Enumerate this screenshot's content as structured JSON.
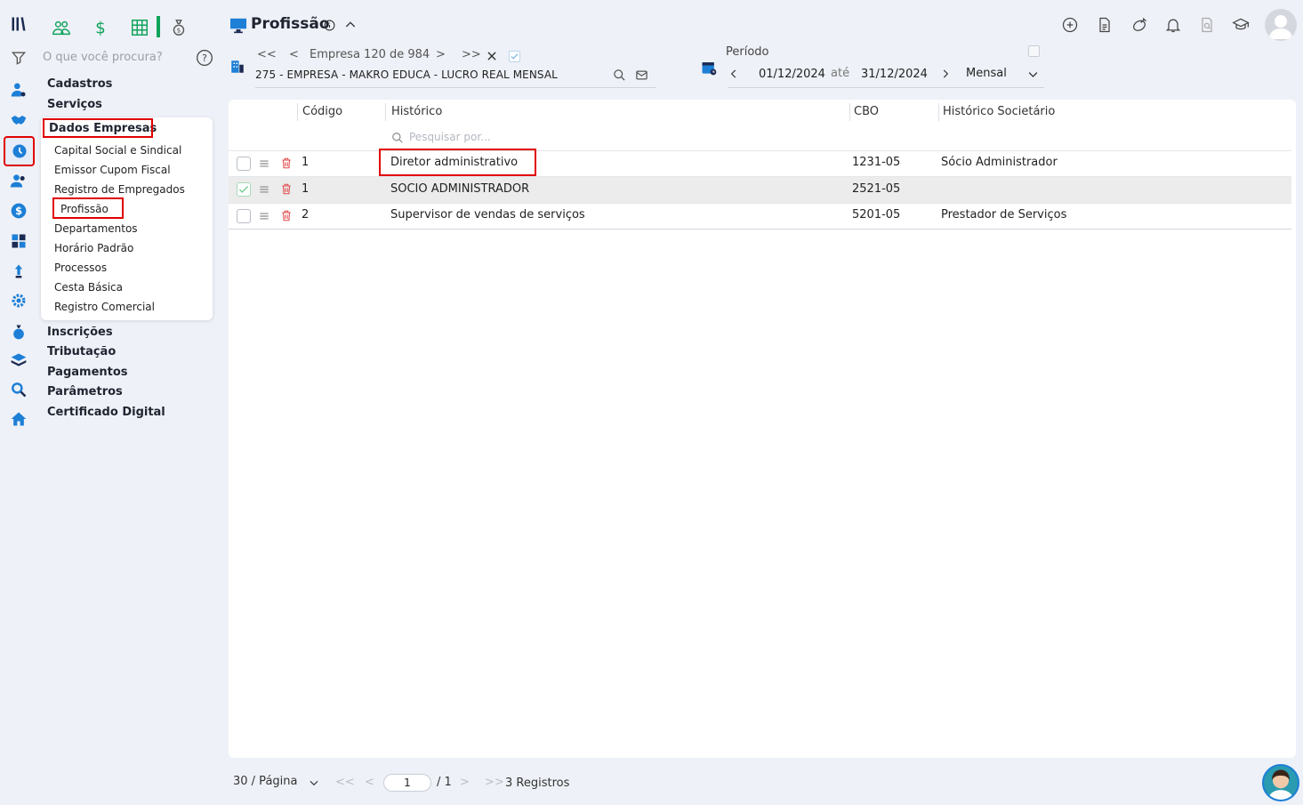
{
  "search": {
    "placeholder": "O que você procura?"
  },
  "menu": {
    "top_items": [
      "Cadastros",
      "Serviços",
      "Dados Empresas"
    ],
    "dados_empresas_items": [
      "Capital Social e Sindical",
      "Emissor Cupom Fiscal",
      "Registro de Empregados",
      "Profissão",
      "Departamentos",
      "Horário Padrão",
      "Processos",
      "Cesta Básica",
      "Registro Comercial"
    ],
    "bottom_items": [
      "Inscrições",
      "Tributação",
      "Pagamentos",
      "Parâmetros",
      "Certificado Digital"
    ]
  },
  "header": {
    "title": "Profissão"
  },
  "company_nav": {
    "first": "<<",
    "prev": "<",
    "label": "Empresa 120 de 984",
    "next": ">",
    "last": ">>",
    "company": "275 - EMPRESA - MAKRO EDUCA - LUCRO REAL MENSAL"
  },
  "period": {
    "label": "Período",
    "start": "01/12/2024",
    "sep": "até",
    "end": "31/12/2024",
    "mode": "Mensal"
  },
  "table": {
    "columns": [
      "Código",
      "Histórico",
      "CBO",
      "Histórico Societário"
    ],
    "filter_placeholder": "Pesquisar por...",
    "rows": [
      {
        "codigo": "1",
        "historico": "Diretor administrativo",
        "cbo": "1231-05",
        "societario": "Sócio Administrador",
        "checked": false
      },
      {
        "codigo": "1",
        "historico": "SOCIO ADMINISTRADOR",
        "cbo": "2521-05",
        "societario": "",
        "checked": true
      },
      {
        "codigo": "2",
        "historico": "Supervisor de vendas de serviços",
        "cbo": "5201-05",
        "societario": "Prestador de Serviços",
        "checked": false
      }
    ]
  },
  "pagination": {
    "per_page": "30 / Página",
    "first": "<<",
    "prev": "<",
    "current_page": "1",
    "total_pages": "/ 1",
    "next": ">",
    "last": ">>",
    "records": "3 Registros"
  },
  "colors": {
    "accent": "#1d7fd6",
    "green": "#11a35b",
    "highlight": "#e00000"
  }
}
